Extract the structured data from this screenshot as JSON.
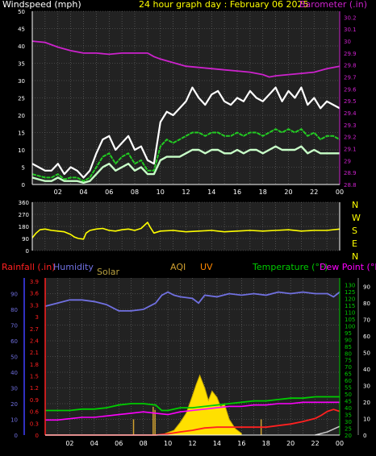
{
  "colors": {
    "background": "#000000",
    "plot_bg": "#222222",
    "grid": "#6b6b6b",
    "axis_white": "#ffffff",
    "magenta": "#cc22cc",
    "yellow": "#ffff00",
    "wind_avg": "#22cc22",
    "wind_gust": "#ffffff",
    "wind_lo": "#c8ffc8",
    "humidity": "#7070e0",
    "rain": "#ff2020",
    "solar": "#b8a040",
    "aqi": "#d0a030",
    "uv": "#ff8800",
    "temp": "#00cc00",
    "dew": "#ff00ff"
  },
  "chart_data": [
    {
      "type": "line",
      "name": "wind_barometer",
      "title": "24 hour graph day : February 06 2025",
      "ylabel_left": "Windspeed (mph)",
      "ylabel_right": "Barometer (.in)",
      "ylim_left": [
        0,
        50
      ],
      "ylim_right": [
        28.8,
        30.25
      ],
      "left_ticks": [
        "0",
        "5",
        "10",
        "15",
        "20",
        "25",
        "30",
        "35",
        "40",
        "45",
        "50"
      ],
      "right_ticks": [
        "28.8",
        "28.9",
        "29",
        "29.1",
        "29.2",
        "29.3",
        "29.4",
        "29.5",
        "29.6",
        "29.7",
        "29.8",
        "29.9",
        "30",
        "30.1",
        "30.2"
      ],
      "x_ticks": [
        "02",
        "04",
        "06",
        "08",
        "10",
        "12",
        "14",
        "16",
        "18",
        "20",
        "22",
        "00"
      ],
      "grid": true,
      "series": [
        {
          "key": "gust",
          "x": [
            0,
            0.5,
            1,
            1.5,
            2,
            2.5,
            3,
            3.5,
            4,
            4.5,
            5,
            5.5,
            6,
            6.5,
            7,
            7.5,
            8,
            8.5,
            9,
            9.5,
            10,
            10.5,
            11,
            11.5,
            12,
            12.5,
            13,
            13.5,
            14,
            14.5,
            15,
            15.5,
            16,
            16.5,
            17,
            17.5,
            18,
            18.5,
            19,
            19.5,
            20,
            20.5,
            21,
            21.5,
            22,
            22.5,
            23,
            23.5,
            24
          ],
          "values": [
            6,
            5,
            4,
            4,
            6,
            3,
            5,
            4,
            2,
            4,
            9,
            13,
            14,
            10,
            12,
            14,
            10,
            11,
            7,
            6,
            18,
            21,
            20,
            22,
            24,
            28,
            25,
            23,
            26,
            27,
            24,
            23,
            25,
            24,
            27,
            25,
            24,
            26,
            28,
            24,
            27,
            25,
            28,
            23,
            25,
            22,
            24,
            23,
            22
          ]
        },
        {
          "key": "avg",
          "x": [
            0,
            0.5,
            1,
            1.5,
            2,
            2.5,
            3,
            3.5,
            4,
            4.5,
            5,
            5.5,
            6,
            6.5,
            7,
            7.5,
            8,
            8.5,
            9,
            9.5,
            10,
            10.5,
            11,
            11.5,
            12,
            12.5,
            13,
            13.5,
            14,
            14.5,
            15,
            15.5,
            16,
            16.5,
            17,
            17.5,
            18,
            18.5,
            19,
            19.5,
            20,
            20.5,
            21,
            21.5,
            22,
            22.5,
            23,
            23.5,
            24
          ],
          "values": [
            3,
            2.5,
            2,
            2,
            3,
            1.5,
            2,
            2,
            1,
            2,
            5,
            8,
            9,
            6,
            8,
            9,
            6,
            7,
            4,
            4,
            11,
            13,
            12,
            13,
            14,
            15,
            15,
            14,
            15,
            15,
            14,
            14,
            15,
            14,
            15,
            15,
            14,
            15,
            16,
            15,
            16,
            15,
            16,
            14,
            15,
            13,
            14,
            14,
            13
          ]
        },
        {
          "key": "lo",
          "x": [
            0,
            0.5,
            1,
            1.5,
            2,
            2.5,
            3,
            3.5,
            4,
            4.5,
            5,
            5.5,
            6,
            6.5,
            7,
            7.5,
            8,
            8.5,
            9,
            9.5,
            10,
            10.5,
            11,
            11.5,
            12,
            12.5,
            13,
            13.5,
            14,
            14.5,
            15,
            15.5,
            16,
            16.5,
            17,
            17.5,
            18,
            18.5,
            19,
            19.5,
            20,
            20.5,
            21,
            21.5,
            22,
            22.5,
            23,
            23.5,
            24
          ],
          "values": [
            2,
            1.5,
            1,
            1,
            2,
            1,
            1,
            1,
            0.5,
            1,
            3,
            5,
            6,
            4,
            5,
            6,
            4,
            5,
            3,
            3,
            7,
            8,
            8,
            8,
            9,
            10,
            10,
            9,
            10,
            10,
            9,
            9,
            10,
            9,
            10,
            10,
            9,
            10,
            11,
            10,
            10,
            10,
            11,
            9,
            10,
            9,
            9,
            9,
            9
          ]
        },
        {
          "key": "barometer",
          "x": [
            0,
            1,
            2,
            3,
            4,
            5,
            6,
            7,
            8,
            9,
            9.5,
            10,
            11,
            12,
            13,
            14,
            15,
            16,
            17,
            18,
            18.5,
            19,
            20,
            21,
            22,
            23,
            24
          ],
          "values": [
            30.0,
            29.99,
            29.95,
            29.92,
            29.9,
            29.9,
            29.89,
            29.9,
            29.9,
            29.9,
            29.87,
            29.85,
            29.82,
            29.79,
            29.78,
            29.77,
            29.76,
            29.75,
            29.74,
            29.72,
            29.7,
            29.71,
            29.72,
            29.73,
            29.74,
            29.77,
            29.79
          ]
        }
      ]
    },
    {
      "type": "line",
      "name": "wind_direction",
      "ylim": [
        0,
        360
      ],
      "y_ticks": [
        "0",
        "90",
        "180",
        "270",
        "360"
      ],
      "right_labels": [
        "N",
        "W",
        "S",
        "E",
        "N"
      ],
      "x_ticks": [
        "02",
        "04",
        "06",
        "08",
        "10",
        "12",
        "14",
        "16",
        "18",
        "20",
        "22",
        "00"
      ],
      "series": [
        {
          "key": "direction",
          "x": [
            0,
            0.3,
            0.6,
            1,
            1.5,
            2,
            2.5,
            3,
            3.3,
            3.6,
            4,
            4.2,
            4.5,
            5,
            5.5,
            6,
            6.5,
            7,
            7.5,
            8,
            8.5,
            9,
            9.2,
            9.5,
            10,
            11,
            12,
            13,
            14,
            15,
            16,
            17,
            18,
            19,
            20,
            21,
            22,
            23,
            24
          ],
          "values": [
            95,
            130,
            155,
            160,
            150,
            145,
            140,
            120,
            100,
            90,
            85,
            130,
            150,
            160,
            165,
            150,
            145,
            155,
            160,
            150,
            165,
            210,
            175,
            130,
            145,
            150,
            140,
            145,
            150,
            140,
            145,
            150,
            145,
            150,
            155,
            145,
            150,
            150,
            160
          ]
        }
      ]
    },
    {
      "type": "line",
      "name": "rain_humidity_temp",
      "labels": {
        "rainfall": "Rainfall (.in)",
        "humidity": "Humidity",
        "solar": "Solar",
        "aqi": "AQI",
        "uv": "UV",
        "temperature": "Temperature (°F)",
        "dew_point": "Dew Point (°F)"
      },
      "ylim_rain": [
        0,
        3.9
      ],
      "rain_ticks": [
        "0",
        "0.3",
        "0.6",
        "0.9",
        "1.2",
        "1.5",
        "1.8",
        "2.1",
        "2.4",
        "2.7",
        "3",
        "3.3",
        "3.6",
        "3.9"
      ],
      "ylim_humidity": [
        0,
        100
      ],
      "humidity_ticks": [
        "0",
        "10",
        "20",
        "30",
        "40",
        "50",
        "60",
        "70",
        "80",
        "90"
      ],
      "ylim_temp": [
        20,
        135
      ],
      "temp_ticks": [
        "20",
        "25",
        "30",
        "35",
        "40",
        "45",
        "50",
        "55",
        "60",
        "65",
        "70",
        "75",
        "80",
        "85",
        "90",
        "95",
        "100",
        "105",
        "110",
        "115",
        "120",
        "125",
        "130"
      ],
      "ylim_uv": [
        0,
        95
      ],
      "uv_ticks": [
        "0",
        "10",
        "20",
        "30",
        "40",
        "50",
        "60",
        "70",
        "80",
        "90"
      ],
      "x_ticks": [
        "02",
        "04",
        "06",
        "08",
        "10",
        "12",
        "14",
        "16",
        "18",
        "20",
        "22",
        "00"
      ],
      "series": [
        {
          "key": "humidity",
          "x": [
            0,
            1,
            2,
            3,
            4,
            5,
            6,
            7,
            8,
            9,
            9.5,
            10,
            10.5,
            11,
            12,
            12.5,
            13,
            14,
            15,
            16,
            17,
            18,
            19,
            20,
            21,
            22,
            23,
            23.5,
            24
          ],
          "values": [
            82,
            84,
            86,
            86,
            85,
            83,
            79,
            79,
            80,
            84,
            89,
            91,
            89,
            88,
            87,
            84,
            89,
            88,
            90,
            89,
            90,
            89,
            91,
            90,
            91,
            90,
            90,
            88,
            91
          ]
        },
        {
          "key": "temperature",
          "x": [
            0,
            1,
            2,
            3,
            4,
            5,
            6,
            7,
            8,
            9,
            9.5,
            10,
            11,
            12,
            13,
            14,
            15,
            16,
            17,
            18,
            19,
            20,
            21,
            22,
            23,
            24
          ],
          "values": [
            38,
            38,
            38,
            39,
            39,
            40,
            42,
            43,
            43,
            42,
            38,
            38,
            40,
            40,
            41,
            42,
            43,
            44,
            45,
            45,
            46,
            47,
            47,
            48,
            48,
            48
          ]
        },
        {
          "key": "dew_point",
          "x": [
            0,
            1,
            2,
            3,
            4,
            5,
            6,
            7,
            8,
            9,
            10,
            11,
            12,
            13,
            14,
            15,
            16,
            17,
            18,
            19,
            20,
            21,
            22,
            23,
            24
          ],
          "values": [
            31,
            31,
            32,
            33,
            33,
            34,
            35,
            36,
            37,
            36,
            35,
            37,
            38,
            39,
            40,
            41,
            41,
            42,
            42,
            43,
            43,
            44,
            44,
            44,
            44
          ]
        },
        {
          "key": "rainfall",
          "x": [
            0,
            9,
            10,
            11,
            12,
            13,
            14,
            15,
            16,
            17,
            18,
            19,
            20,
            21,
            22,
            22.5,
            23,
            23.5,
            24
          ],
          "values": [
            0,
            0,
            0.03,
            0.08,
            0.12,
            0.18,
            0.2,
            0.2,
            0.2,
            0.2,
            0.2,
            0.24,
            0.28,
            0.34,
            0.42,
            0.5,
            0.6,
            0.65,
            0.6
          ]
        },
        {
          "key": "solar",
          "x": [
            9.8,
            10.5,
            11,
            11.5,
            12,
            12.3,
            12.6,
            13,
            13.3,
            13.6,
            14,
            14.3,
            14.6,
            15,
            15.5,
            16
          ],
          "values": [
            1,
            3,
            8,
            14,
            25,
            32,
            38,
            30,
            22,
            28,
            24,
            18,
            20,
            10,
            4,
            1
          ]
        },
        {
          "key": "uv_daily",
          "x": [
            22,
            23,
            24
          ],
          "values": [
            0,
            0.08,
            0.22
          ]
        }
      ]
    }
  ]
}
